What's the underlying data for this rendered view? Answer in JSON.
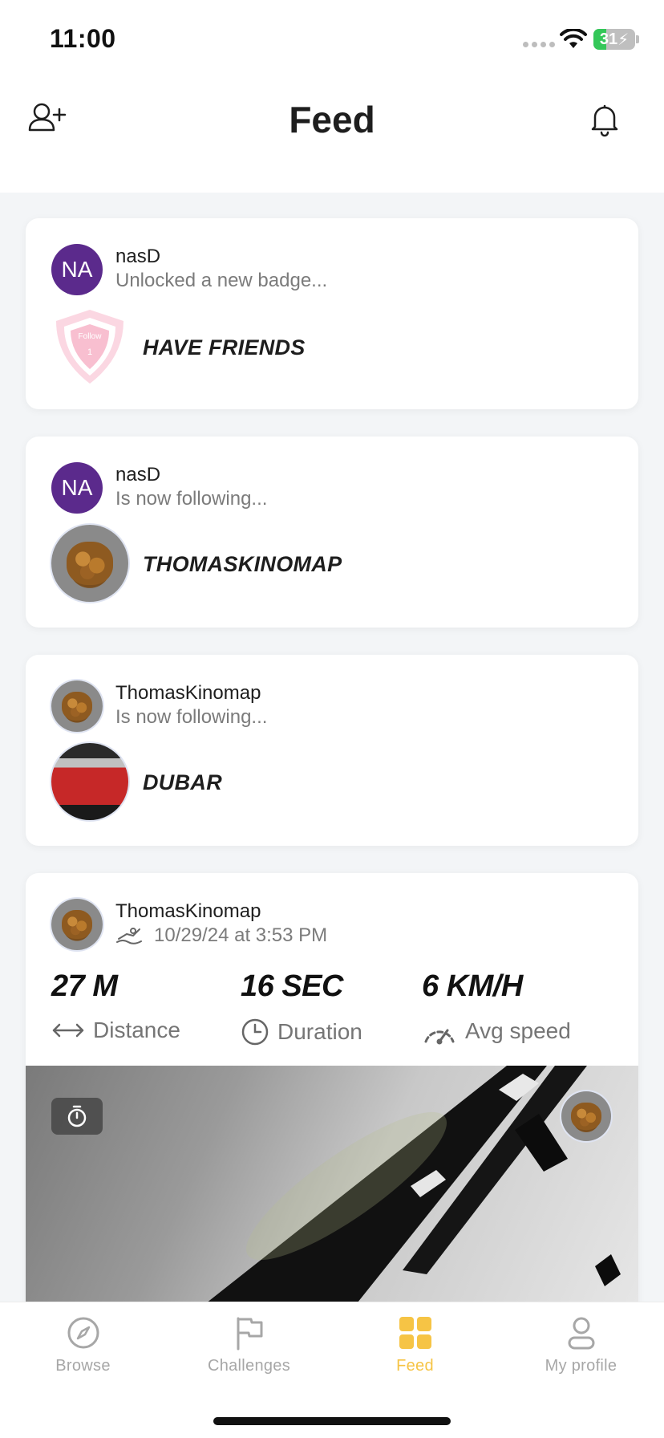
{
  "status_bar": {
    "time": "11:00",
    "battery": "31"
  },
  "header": {
    "title": "Feed",
    "left_icon": "add-user-icon",
    "right_icon": "bell-icon"
  },
  "feed": [
    {
      "user": "nasD",
      "initials": "NA",
      "action": "Unlocked a new badge...",
      "target": "HAVE FRIENDS",
      "badge_icon": "follow-badge-icon",
      "badge_text": "Follow",
      "badge_count": "1"
    },
    {
      "user": "nasD",
      "initials": "NA",
      "action": "Is now following...",
      "target": "THOMASKINOMAP"
    },
    {
      "user": "ThomasKinomap",
      "action": "Is now following...",
      "target": "DUBAR"
    },
    {
      "user": "ThomasKinomap",
      "date": "10/29/24 at 3:53 PM",
      "sport_icon": "rowing-icon",
      "stats": [
        {
          "value": "27 M",
          "label": "Distance",
          "icon": "distance-arrows-icon"
        },
        {
          "value": "16 SEC",
          "label": "Duration",
          "icon": "clock-icon"
        },
        {
          "value": "6 KM/H",
          "label": "Avg speed",
          "icon": "speedometer-icon"
        }
      ]
    }
  ],
  "tabs": [
    {
      "label": "Browse",
      "icon": "compass-icon",
      "active": false
    },
    {
      "label": "Challenges",
      "icon": "flag-icon",
      "active": false
    },
    {
      "label": "Feed",
      "icon": "grid-icon",
      "active": true
    },
    {
      "label": "My profile",
      "icon": "user-icon",
      "active": false
    }
  ],
  "colors": {
    "accent": "#f6c445",
    "avatar_purple": "#5b2a8c",
    "battery_green": "#34c759"
  }
}
